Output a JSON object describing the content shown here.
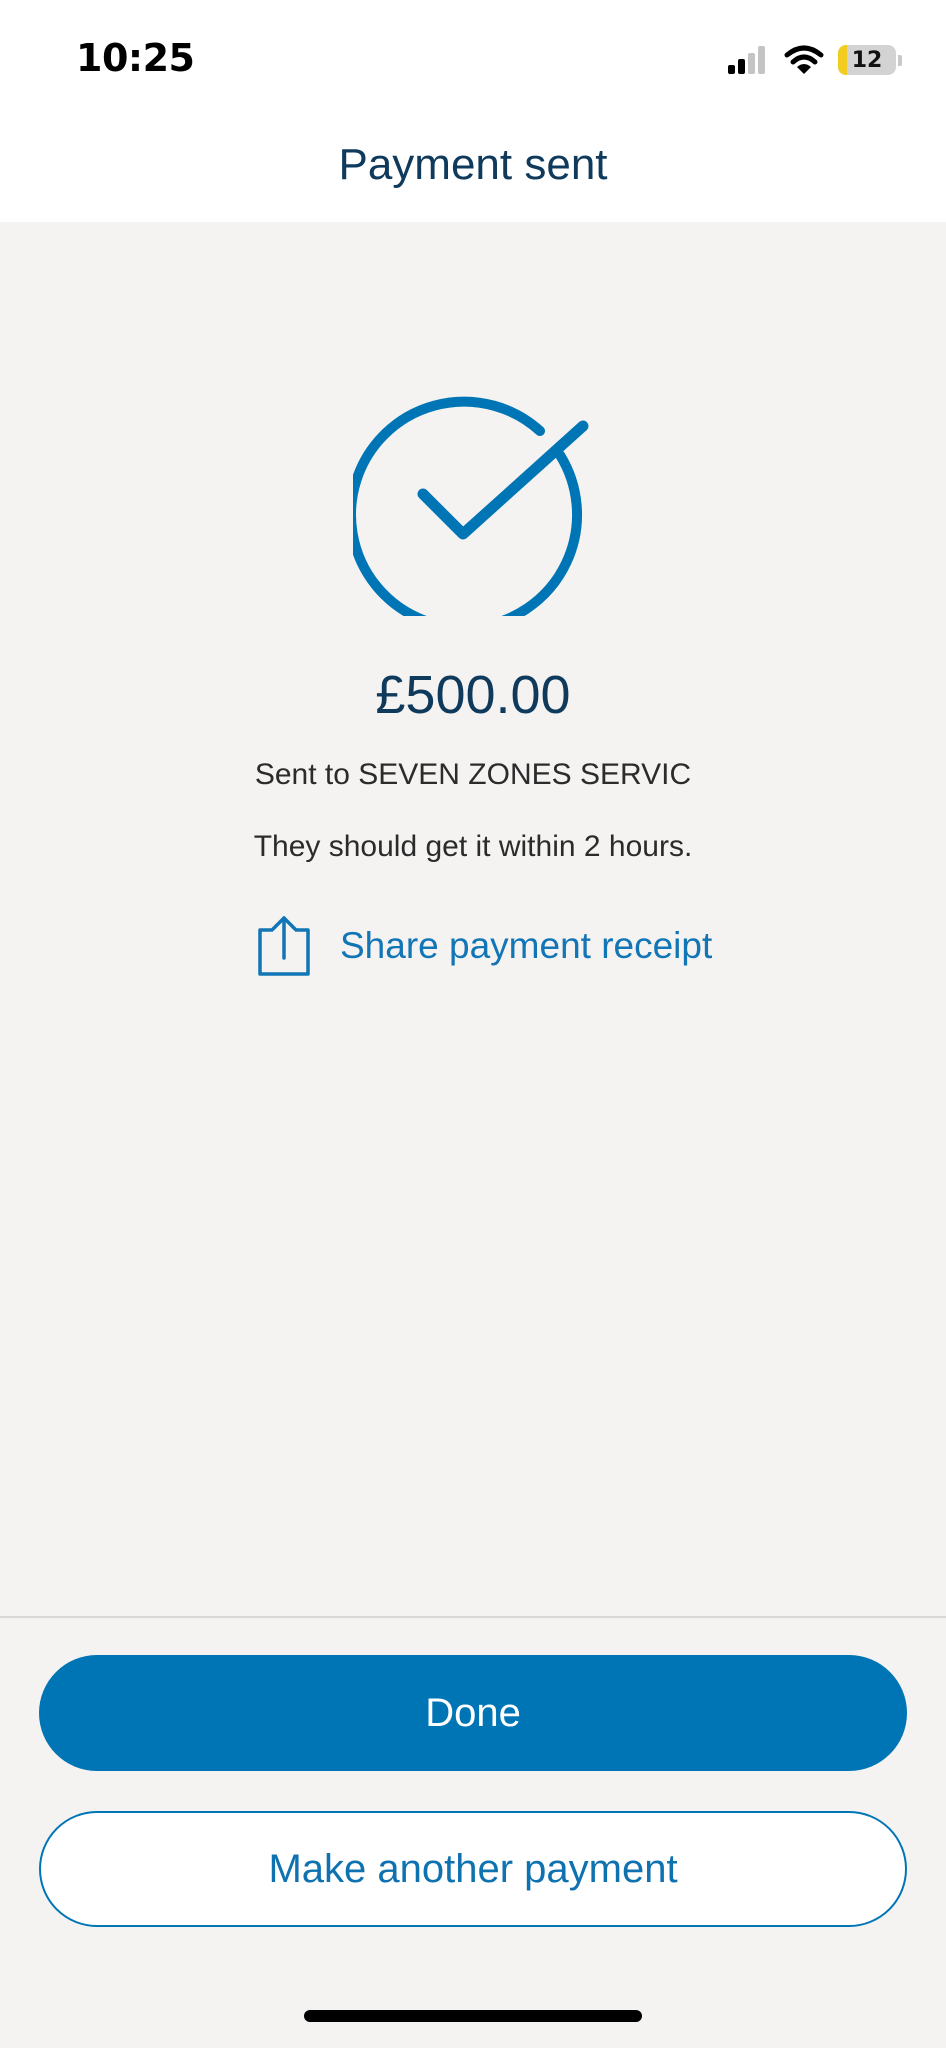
{
  "status_bar": {
    "time": "10:25",
    "battery_level": "12",
    "icons": [
      "cellular-signal-icon",
      "wifi-icon",
      "battery-icon"
    ]
  },
  "header": {
    "title": "Payment sent"
  },
  "confirmation": {
    "icon": "check-circle-icon",
    "amount": "£500.00",
    "recipient_line": "Sent to SEVEN ZONES SERVIC",
    "eta_line": "They should get it within 2 hours.",
    "share_label": "Share payment receipt",
    "share_icon": "share-upload-icon"
  },
  "actions": {
    "done_label": "Done",
    "another_label": "Make another payment"
  },
  "colors": {
    "accent": "#0075b6",
    "title": "#0f3a5c",
    "background": "#f4f3f2",
    "battery_low": "#f2cd1f"
  }
}
